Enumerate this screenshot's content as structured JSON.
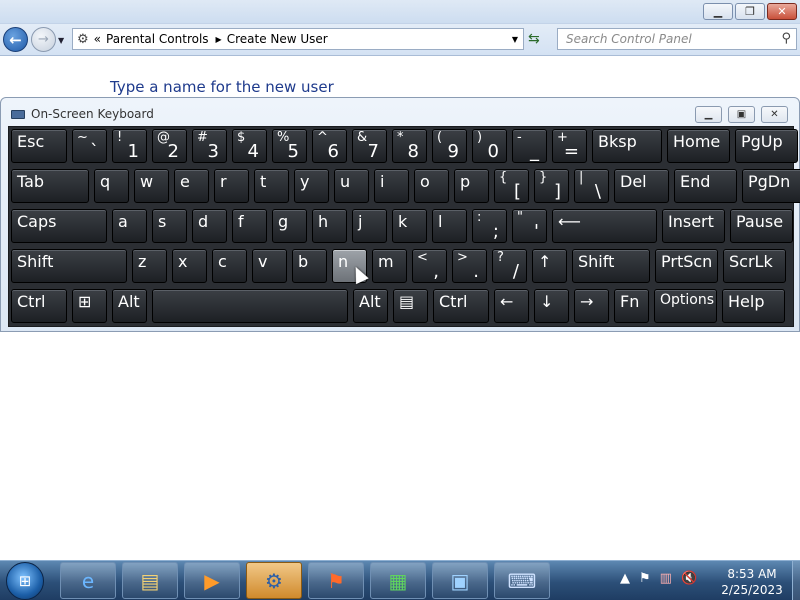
{
  "window": {
    "minimize_icon": "minimize-icon",
    "maximize_icon": "maximize-icon",
    "close_icon": "close-icon"
  },
  "nav": {
    "back_icon": "back-arrow-icon",
    "forward_icon": "forward-arrow-icon",
    "address_overflow": "«",
    "breadcrumbs": [
      "Parental Controls",
      "Create New User"
    ],
    "search_placeholder": "Search Control Panel"
  },
  "page": {
    "heading": "Type a name for the new user"
  },
  "osk": {
    "title": "On-Screen Keyboard",
    "highlighted_key": "n",
    "rows": [
      [
        "Esc",
        "~`",
        "!1",
        "@2",
        "#3",
        "$4",
        "%5",
        "^6",
        "&7",
        "*8",
        "(9",
        ")0",
        "-_",
        "+=",
        "Bksp",
        "Home",
        "PgUp"
      ],
      [
        "Tab",
        "q",
        "w",
        "e",
        "r",
        "t",
        "y",
        "u",
        "i",
        "o",
        "p",
        "{[",
        "}]",
        "|\\",
        "Del",
        "End",
        "PgDn"
      ],
      [
        "Caps",
        "a",
        "s",
        "d",
        "f",
        "g",
        "h",
        "j",
        "k",
        "l",
        ":;",
        "\"'",
        "⟵",
        "Insert",
        "Pause"
      ],
      [
        "Shift",
        "z",
        "x",
        "c",
        "v",
        "b",
        "n",
        "m",
        "<,",
        ">.",
        "?/",
        "↑",
        "Shift",
        "PrtScn",
        "ScrLk"
      ],
      [
        "Ctrl",
        "⊞",
        "Alt",
        "",
        "Alt",
        "▤",
        "Ctrl",
        "←",
        "↓",
        "→",
        "Fn",
        "Options",
        "Help"
      ]
    ]
  },
  "taskbar": {
    "start_icon": "windows-start-icon",
    "pinned": [
      "internet-explorer-icon",
      "windows-explorer-icon",
      "media-player-icon",
      "control-panel-icon",
      "windows-flag-icon",
      "task-manager-icon",
      "network-icon",
      "on-screen-keyboard-icon"
    ],
    "active_index": 3,
    "tray_icons": [
      "show-hidden-icons",
      "action-center-icon",
      "network-status-icon",
      "volume-muted-icon"
    ],
    "time": "8:53 AM",
    "date": "2/25/2023"
  }
}
